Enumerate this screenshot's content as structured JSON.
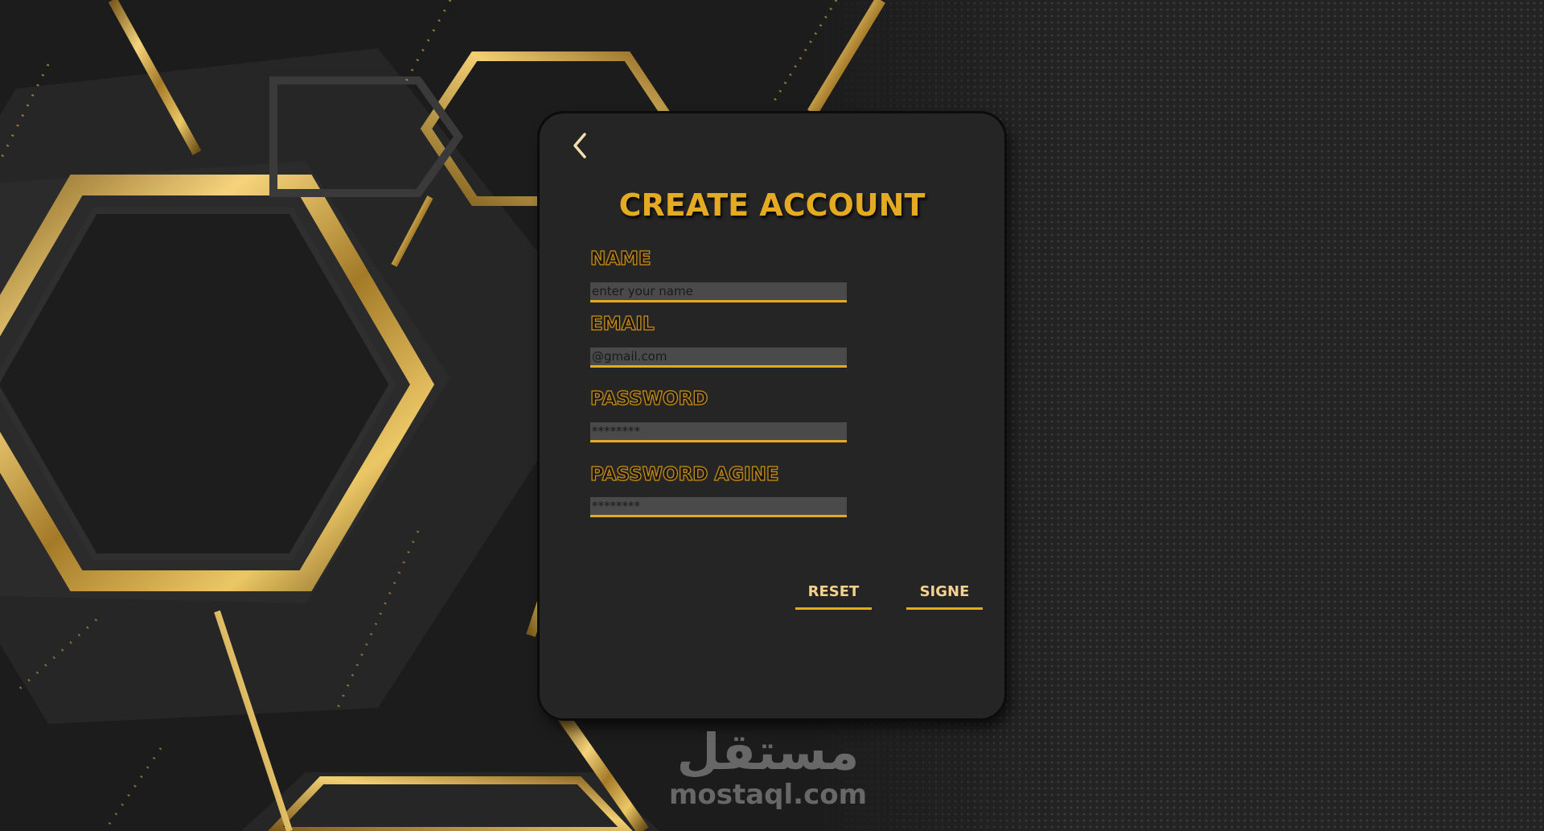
{
  "form": {
    "title": "CREATE ACCOUNT",
    "fields": [
      {
        "label": "NAME",
        "placeholder": "enter your name"
      },
      {
        "label": "EMAIL",
        "placeholder": "@gmail.com"
      },
      {
        "label": "PASSWORD",
        "placeholder": "********"
      },
      {
        "label": "PASSWORD AGINE",
        "placeholder": "********"
      }
    ],
    "buttons": {
      "reset_label": "RESET",
      "sign_label": "SIGNE"
    }
  },
  "watermark": {
    "arabic": "مستقل",
    "latin": "mostaql.com"
  },
  "colors": {
    "accent_gold": "#e3aa22",
    "card_bg": "#252525",
    "input_bg": "#4a4a4a",
    "page_bg": "#1c1c1c"
  },
  "icons": {
    "back": "chevron-left-icon"
  }
}
